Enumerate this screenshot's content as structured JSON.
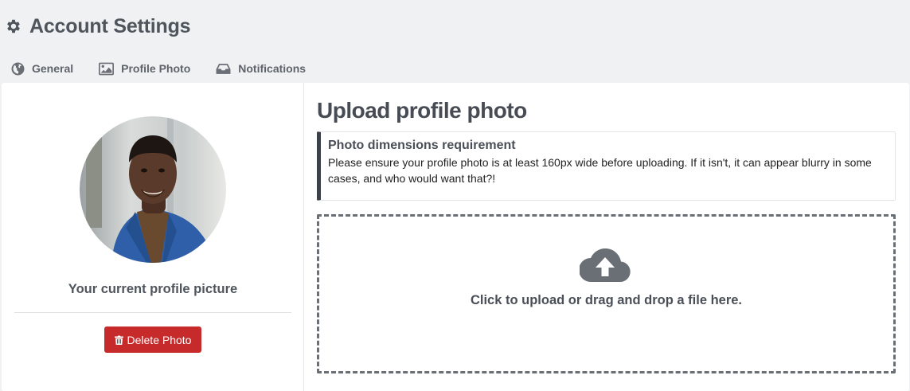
{
  "header": {
    "title": "Account Settings",
    "icon": "gear-icon"
  },
  "tabs": [
    {
      "label": "General",
      "icon": "globe-icon"
    },
    {
      "label": "Profile Photo",
      "icon": "image-icon"
    },
    {
      "label": "Notifications",
      "icon": "inbox-icon"
    }
  ],
  "left_panel": {
    "current_label": "Your current profile picture",
    "delete_label": "Delete Photo",
    "delete_color": "#c62a2a"
  },
  "right_panel": {
    "title": "Upload profile photo",
    "notice_title": "Photo dimensions requirement",
    "notice_text": "Please ensure your profile photo is at least 160px wide before uploading. If it isn't, it can appear blurry in some cases, and who would want that?!",
    "dropzone_text": "Click to upload or drag and drop a file here."
  }
}
